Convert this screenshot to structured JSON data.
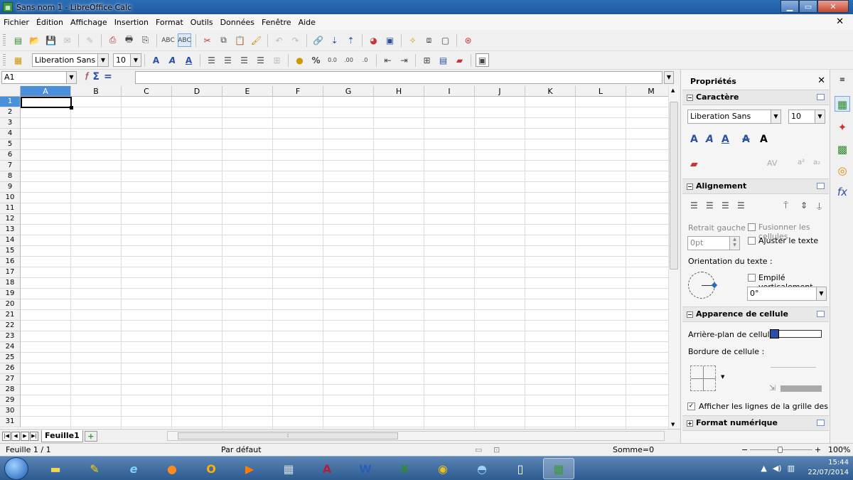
{
  "window": {
    "title": "Sans nom 1 - LibreOffice Calc",
    "doc_close": "✕"
  },
  "menu": [
    "Fichier",
    "Édition",
    "Affichage",
    "Insertion",
    "Format",
    "Outils",
    "Données",
    "Fenêtre",
    "Aide"
  ],
  "formatting": {
    "font_name": "Liberation Sans",
    "font_size": "10"
  },
  "formula_bar": {
    "cell_ref": "A1",
    "content": ""
  },
  "columns": [
    "A",
    "B",
    "C",
    "D",
    "E",
    "F",
    "G",
    "H",
    "I",
    "J",
    "K",
    "L",
    "M"
  ],
  "rows": [
    "1",
    "2",
    "3",
    "4",
    "5",
    "6",
    "7",
    "8",
    "9",
    "10",
    "11",
    "12",
    "13",
    "14",
    "15",
    "16",
    "17",
    "18",
    "19",
    "20",
    "21",
    "22",
    "23",
    "24",
    "25",
    "26",
    "27",
    "28",
    "29",
    "30",
    "31"
  ],
  "active_cell": {
    "column": "A",
    "row": "1"
  },
  "sheets": {
    "tabs": [
      "Feuille1"
    ],
    "add": "+"
  },
  "status": {
    "sheet": "Feuille 1 / 1",
    "style": "Par défaut",
    "sum": "Somme=0",
    "zoom": "100%"
  },
  "sidebar": {
    "title": "Propriétés",
    "character": {
      "header": "Caractère",
      "font_name": "Liberation Sans",
      "font_size": "10"
    },
    "alignment": {
      "header": "Alignement",
      "indent_label": "Retrait gauche :",
      "indent_value": "0pt",
      "merge_label": "Fusionner les cellules",
      "wrap_label": "Ajuster le texte",
      "orientation_label": "Orientation du texte :",
      "stacked_label": "Empilé verticalement",
      "angle": "0°"
    },
    "cell_appearance": {
      "header": "Apparence de cellule",
      "background_label": "Arrière-plan de cellule :",
      "border_label": "Bordure de cellule :",
      "gridlines_label": "Afficher les lignes de la grille des cellules",
      "gridlines_checked": true
    },
    "number_format": {
      "header": "Format numérique"
    }
  },
  "taskbar": {
    "time": "15:44",
    "date": "22/07/2014"
  }
}
